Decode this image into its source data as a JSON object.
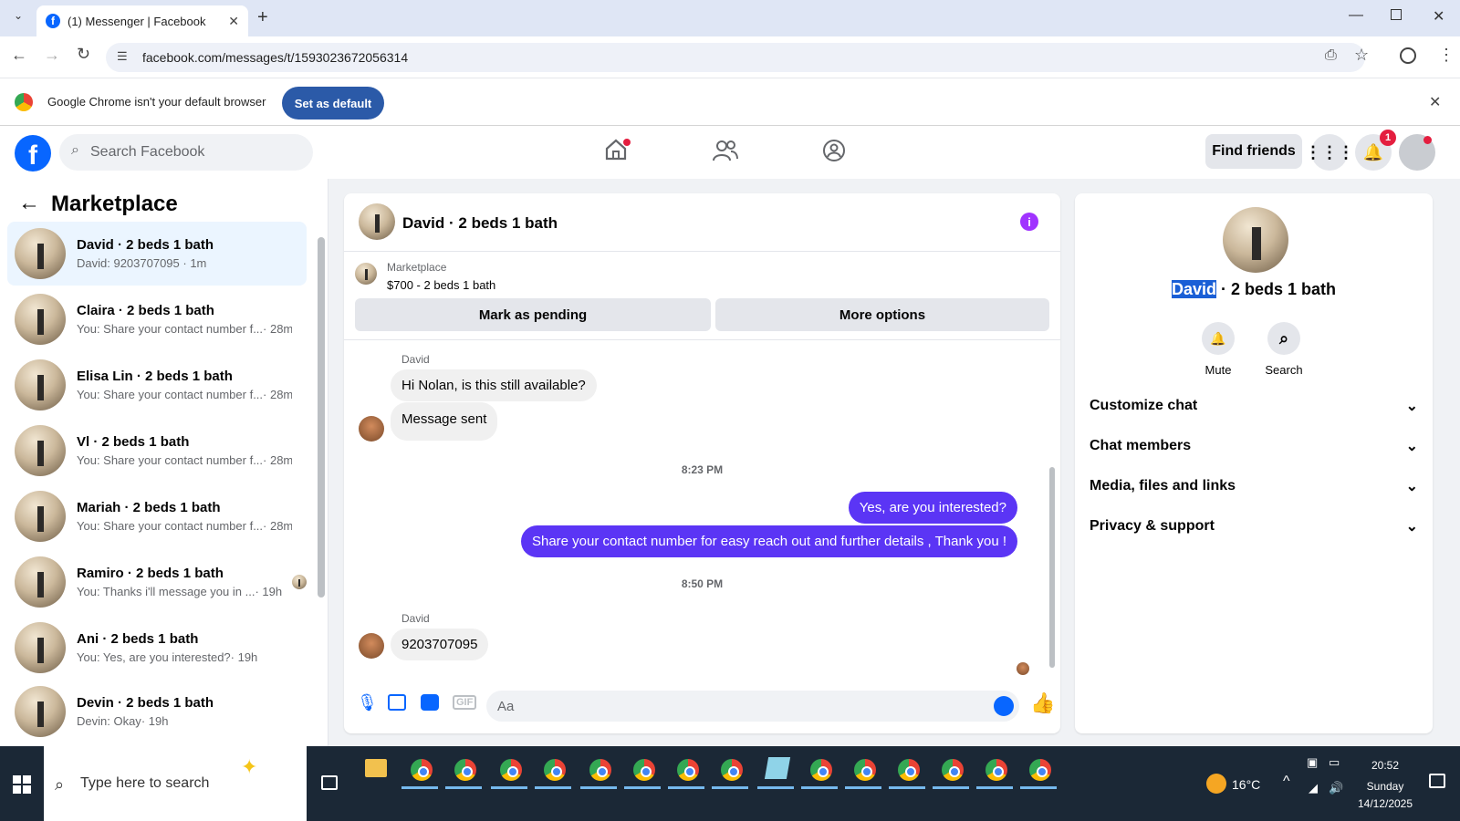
{
  "browser": {
    "tab_title": "(1) Messenger | Facebook",
    "url": "facebook.com/messages/t/1593023672056314",
    "infobar_text": "Google Chrome isn't your default browser",
    "set_default_label": "Set as default"
  },
  "fb": {
    "search_placeholder": "Search Facebook",
    "find_friends_label": "Find friends",
    "notification_count": "1"
  },
  "sidebar": {
    "title": "Marketplace",
    "conversations": [
      {
        "name": "David · 2 beds 1 bath",
        "preview": "David: 9203707095 · 1m",
        "active": true
      },
      {
        "name": "Claira · 2 beds 1 bath",
        "preview": "You: Share your contact number f...",
        "time": "· 28m"
      },
      {
        "name": "Elisa Lin · 2 beds 1 bath",
        "preview": "You: Share your contact number f...",
        "time": "· 28m"
      },
      {
        "name": "Vl · 2 beds 1 bath",
        "preview": "You: Share your contact number f...",
        "time": "· 28m"
      },
      {
        "name": "Mariah · 2 beds 1 bath",
        "preview": "You: Share your contact number f...",
        "time": "· 28m"
      },
      {
        "name": "Ramiro · 2 beds 1 bath",
        "preview": "You: Thanks i'll message you in ...",
        "time": "· 19h"
      },
      {
        "name": "Ani · 2 beds 1 bath",
        "preview": "You: Yes, are you interested?",
        "time": "· 19h"
      },
      {
        "name": "Devin · 2 beds 1 bath",
        "preview": "Devin: Okay",
        "time": "· 19h"
      }
    ]
  },
  "chat": {
    "header_title": "David · 2 beds 1 bath",
    "listing_source": "Marketplace",
    "listing_title": "$700 - 2 beds 1 bath",
    "mark_pending_label": "Mark as pending",
    "more_options_label": "More options",
    "messages": {
      "sender1": "David",
      "msg1": "Hi Nolan, is this still available?",
      "msg2": "Message sent",
      "time1": "8:23 PM",
      "out1": "Yes, are you interested?",
      "out2": "Share your contact number for easy reach out and further details , Thank you !",
      "time2": "8:50 PM",
      "sender2": "David",
      "msg3": "9203707095"
    },
    "composer_placeholder": "Aa"
  },
  "details": {
    "name_highlight": "David",
    "name_rest": " · 2 beds 1 bath",
    "mute_label": "Mute",
    "search_label": "Search",
    "sections": [
      "Customize chat",
      "Chat members",
      "Media, files and links",
      "Privacy & support"
    ]
  },
  "taskbar": {
    "search_placeholder": "Type here to search",
    "weather": "16°C",
    "time": "20:52",
    "day": "Sunday",
    "date": "14/12/2025"
  },
  "colors": {
    "fb_blue": "#0866ff",
    "outgoing_bubble": "#5b35f5",
    "info_purple": "#a033ff"
  }
}
